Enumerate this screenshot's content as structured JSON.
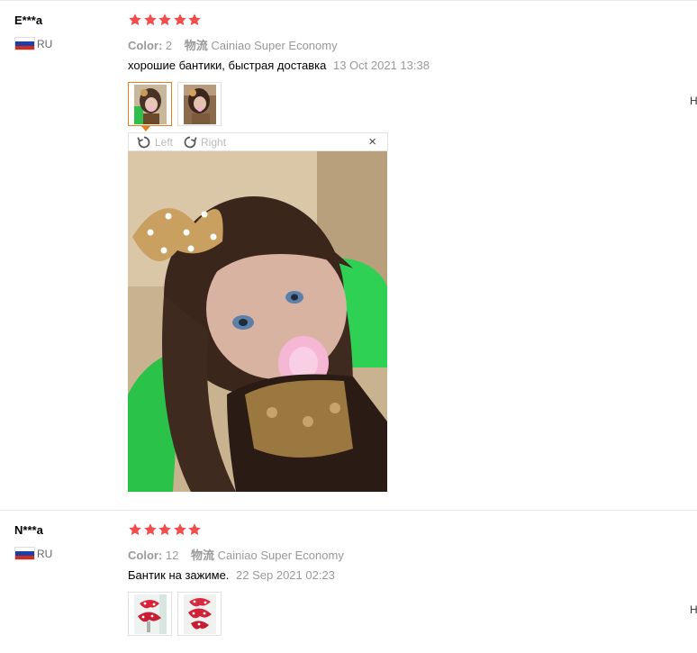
{
  "reviews": [
    {
      "user": "E***a",
      "country": "RU",
      "rating": 5,
      "color_label": "Color:",
      "color_value": "2",
      "shipping_label": "物流",
      "shipping_value": "Cainiao Super Economy",
      "comment": "хорошие бантики, быстрая доставка",
      "date": "13 Oct 2021 13:38",
      "side_text": "H"
    },
    {
      "user": "N***a",
      "country": "RU",
      "rating": 5,
      "color_label": "Color:",
      "color_value": "12",
      "shipping_label": "物流",
      "shipping_value": "Cainiao Super Economy",
      "comment": "Бантик на зажиме.",
      "date": "22 Sep 2021 02:23",
      "side_text": "H"
    }
  ],
  "viewer": {
    "rotate_left_label": "Left",
    "rotate_right_label": "Right",
    "close_label": "×"
  },
  "colors": {
    "star": "#f04d4d",
    "active_border": "#e67e22",
    "muted": "#999999",
    "flag_white": "#ffffff",
    "flag_blue": "#1c3fa8",
    "flag_red": "#d52b1e"
  },
  "icons": {
    "star": "star-icon",
    "rotate_left": "rotate-left-icon",
    "rotate_right": "rotate-right-icon",
    "close": "close-icon",
    "flag": "russia-flag-icon"
  }
}
